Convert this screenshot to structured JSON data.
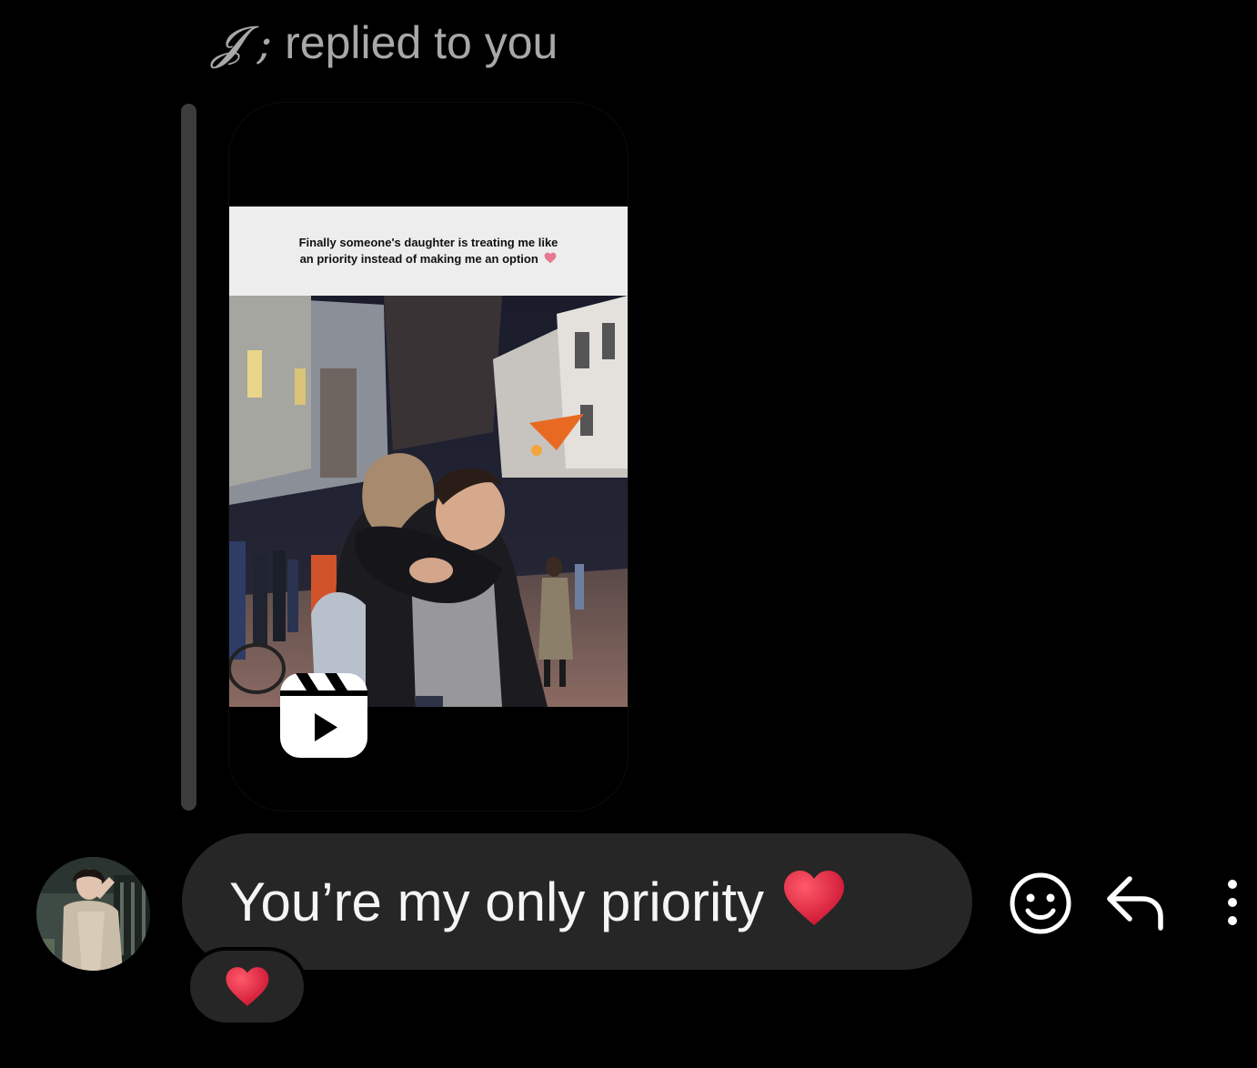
{
  "reply_header": {
    "name": "𝓙 ;",
    "text": "replied to you"
  },
  "shared_reel": {
    "caption": "Finally someone's daughter is treating me like an priority instead of making me an option",
    "caption_emoji": "heart-icon",
    "icon": "reels-play-icon"
  },
  "message": {
    "avatar": "avatar",
    "text": "You’re my only priority",
    "emoji": "❤️"
  },
  "reaction": {
    "emoji": "❤️"
  },
  "actions": {
    "react_icon": "smiley-icon",
    "reply_icon": "reply-arrow-icon",
    "more_icon": "more-vertical-icon"
  },
  "colors": {
    "background": "#000000",
    "bubble": "#262626",
    "header_text": "#a8a8a8",
    "message_text": "#f5f5f5",
    "heart": "#e0245e"
  }
}
